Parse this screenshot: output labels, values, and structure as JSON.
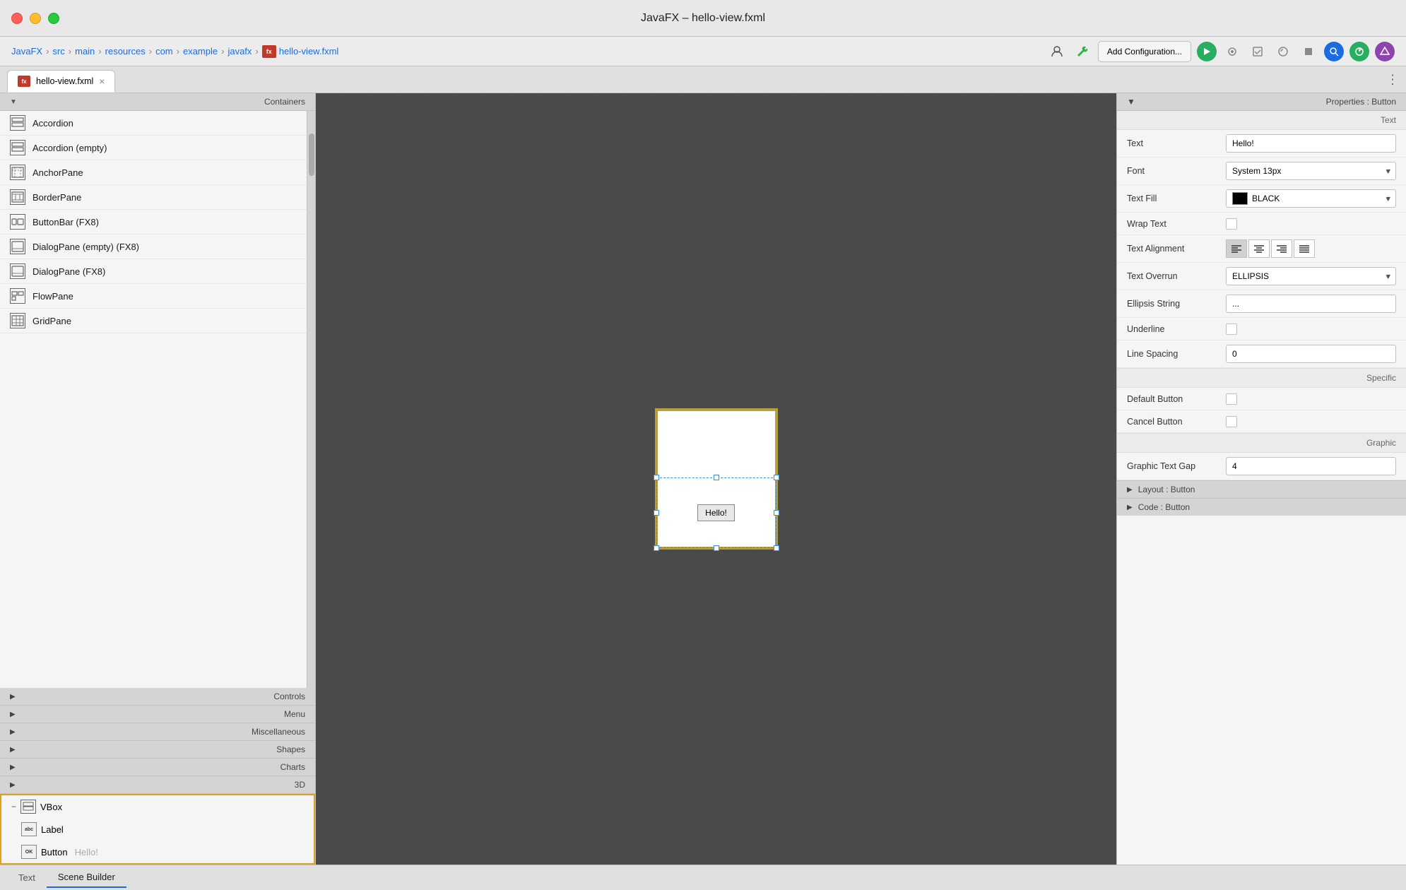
{
  "window": {
    "title": "JavaFX – hello-view.fxml",
    "tab_name": "hello-view.fxml"
  },
  "breadcrumb": {
    "items": [
      "JavaFX",
      "src",
      "main",
      "resources",
      "com",
      "example",
      "javafx"
    ],
    "file": "hello-view.fxml"
  },
  "toolbar": {
    "add_config": "Add Configuration...",
    "person_icon": "👤",
    "wrench_icon": "🔧"
  },
  "containers": {
    "label": "Containers",
    "items": [
      {
        "name": "Accordion"
      },
      {
        "name": "Accordion  (empty)"
      },
      {
        "name": "AnchorPane"
      },
      {
        "name": "BorderPane"
      },
      {
        "name": "ButtonBar  (FX8)"
      },
      {
        "name": "DialogPane (empty)  (FX8)"
      },
      {
        "name": "DialogPane  (FX8)"
      },
      {
        "name": "FlowPane"
      },
      {
        "name": "GridPane"
      }
    ]
  },
  "sections": {
    "controls": "Controls",
    "menu": "Menu",
    "miscellaneous": "Miscellaneous",
    "shapes": "Shapes",
    "charts": "Charts",
    "three_d": "3D"
  },
  "scene_tree": {
    "vbox": "VBox",
    "label": "Label",
    "button": "Button",
    "button_text": "Hello!"
  },
  "properties": {
    "header": "Properties : Button",
    "section_text": "Text",
    "text_label": "Text",
    "text_value": "Hello!",
    "font_label": "Font",
    "font_value": "System 13px",
    "text_fill_label": "Text Fill",
    "text_fill_value": "BLACK",
    "wrap_text_label": "Wrap Text",
    "text_alignment_label": "Text Alignment",
    "text_overrun_label": "Text Overrun",
    "text_overrun_value": "ELLIPSIS",
    "ellipsis_string_label": "Ellipsis String",
    "ellipsis_string_value": "...",
    "underline_label": "Underline",
    "line_spacing_label": "Line Spacing",
    "line_spacing_value": "0",
    "section_specific": "Specific",
    "default_button_label": "Default Button",
    "cancel_button_label": "Cancel Button",
    "section_graphic": "Graphic",
    "graphic_text_gap_label": "Graphic Text Gap",
    "graphic_text_gap_value": "4"
  },
  "footer": {
    "layout_button": "Layout : Button",
    "code_button": "Code : Button"
  },
  "bottom_tabs": {
    "text": "Text",
    "scene_builder": "Scene Builder"
  }
}
